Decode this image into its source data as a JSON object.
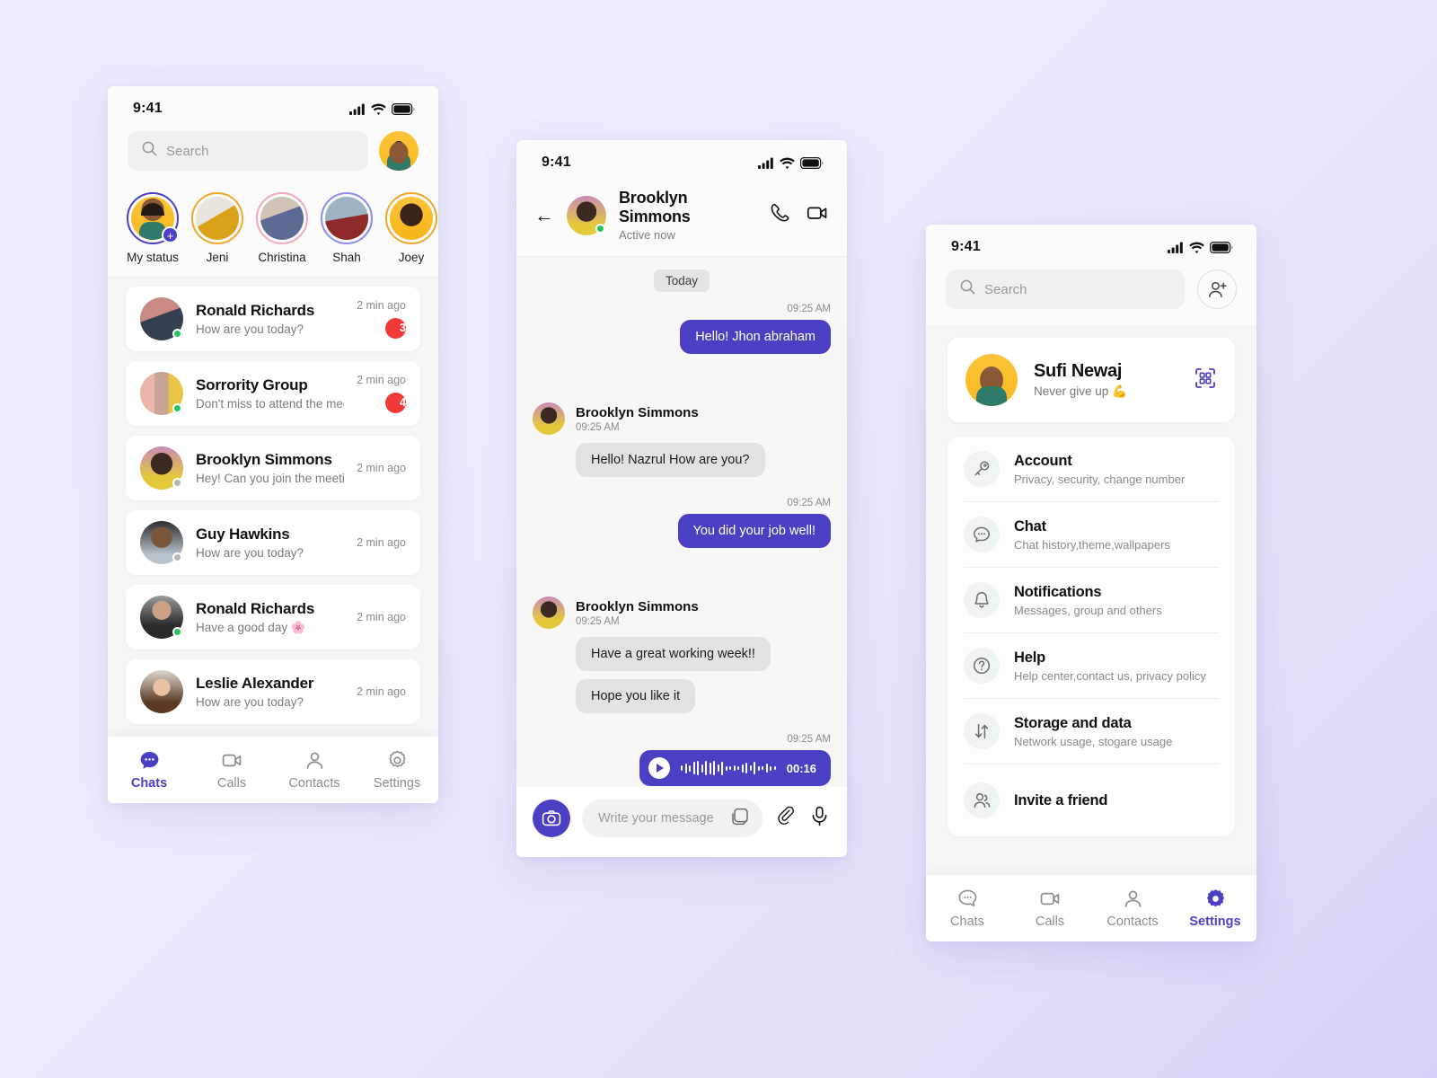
{
  "theme": {
    "accent": "#4b3fc4",
    "badge": "#f03a3a",
    "online": "#22c55e",
    "bg_from": "#ecebfd",
    "bg_to": "#d5d3f7"
  },
  "status_bar": {
    "time": "9:41",
    "icons": [
      "signal-icon",
      "wifi-icon",
      "battery-icon"
    ]
  },
  "phone_chats": {
    "search": {
      "placeholder": "Search",
      "icon": "search-icon"
    },
    "profile_avatar": "my-avatar",
    "stories": [
      {
        "name": "My status",
        "ring": "#4b3fc4",
        "add": "+"
      },
      {
        "name": "Jeni",
        "ring": "#efa82a"
      },
      {
        "name": "Christina",
        "ring": "#f0a9c0"
      },
      {
        "name": "Shah",
        "ring": "#8d8bf0"
      },
      {
        "name": "Joey",
        "ring": "#efa82a"
      }
    ],
    "chats": [
      {
        "name": "Ronald Richards",
        "message": "How are you today?",
        "time": "2 min ago",
        "unread": "3",
        "presence": "on"
      },
      {
        "name": "Sorrority Group",
        "message": "Don't miss to attend the meeting.",
        "time": "2 min ago",
        "unread": "4",
        "presence": "on"
      },
      {
        "name": "Brooklyn Simmons",
        "message": "Hey! Can you join the meeting?",
        "time": "2 min ago",
        "unread": "",
        "presence": "off"
      },
      {
        "name": "Guy Hawkins",
        "message": "How are you today?",
        "time": "2 min ago",
        "unread": "",
        "presence": "off"
      },
      {
        "name": "Ronald Richards",
        "message": "Have a good day 🌸",
        "time": "2 min ago",
        "unread": "",
        "presence": "on"
      },
      {
        "name": "Leslie Alexander",
        "message": "How are you today?",
        "time": "2 min ago",
        "unread": "",
        "presence": "off"
      }
    ],
    "tabs": [
      {
        "label": "Chats",
        "icon": "chat-bubble-icon",
        "active": true
      },
      {
        "label": "Calls",
        "icon": "video-camera-icon",
        "active": false
      },
      {
        "label": "Contacts",
        "icon": "person-icon",
        "active": false
      },
      {
        "label": "Settings",
        "icon": "gear-icon",
        "active": false
      }
    ]
  },
  "phone_thread": {
    "header": {
      "back": "←",
      "name": "Brooklyn Simmons",
      "status": "Active now",
      "call_icon": "phone-icon",
      "video_icon": "video-camera-icon"
    },
    "day_divider": "Today",
    "messages": [
      {
        "kind": "out",
        "time": "09:25 AM",
        "text": "Hello! Jhon abraham"
      },
      {
        "kind": "in",
        "time": "09:25 AM",
        "sender": "Brooklyn Simmons",
        "texts": [
          "Hello! Nazrul How are you?"
        ]
      },
      {
        "kind": "out",
        "time": "09:25 AM",
        "text": "You did your job well!"
      },
      {
        "kind": "in",
        "time": "09:25 AM",
        "sender": "Brooklyn Simmons",
        "texts": [
          "Have a great working week!!",
          "Hope you like it"
        ]
      },
      {
        "kind": "voice",
        "time": "09:25 AM",
        "duration": "00:16"
      }
    ],
    "composer": {
      "camera_icon": "camera-icon",
      "placeholder": "Write your message",
      "sticker_icon": "sticker-icon",
      "attach_icon": "paperclip-icon",
      "mic_icon": "microphone-icon"
    }
  },
  "phone_settings": {
    "search": {
      "placeholder": "Search",
      "icon": "search-icon"
    },
    "add_contact_icon": "add-person-icon",
    "profile": {
      "name": "Sufi Newaj",
      "status": "Never give up 💪",
      "qr_icon": "qr-code-icon"
    },
    "menu": [
      {
        "title": "Account",
        "subtitle": "Privacy, security, change number",
        "icon": "key-icon"
      },
      {
        "title": "Chat",
        "subtitle": "Chat history,theme,wallpapers",
        "icon": "chat-bubble-icon"
      },
      {
        "title": "Notifications",
        "subtitle": "Messages, group and others",
        "icon": "bell-icon"
      },
      {
        "title": "Help",
        "subtitle": "Help center,contact us, privacy policy",
        "icon": "question-circle-icon"
      },
      {
        "title": "Storage and data",
        "subtitle": "Network usage, stogare usage",
        "icon": "arrows-updown-icon"
      },
      {
        "title": "Invite a friend",
        "subtitle": "",
        "icon": "people-icon"
      }
    ],
    "tabs": [
      {
        "label": "Chats",
        "icon": "chat-bubble-icon",
        "active": false
      },
      {
        "label": "Calls",
        "icon": "video-camera-icon",
        "active": false
      },
      {
        "label": "Contacts",
        "icon": "person-icon",
        "active": false
      },
      {
        "label": "Settings",
        "icon": "gear-icon",
        "active": true
      }
    ]
  }
}
